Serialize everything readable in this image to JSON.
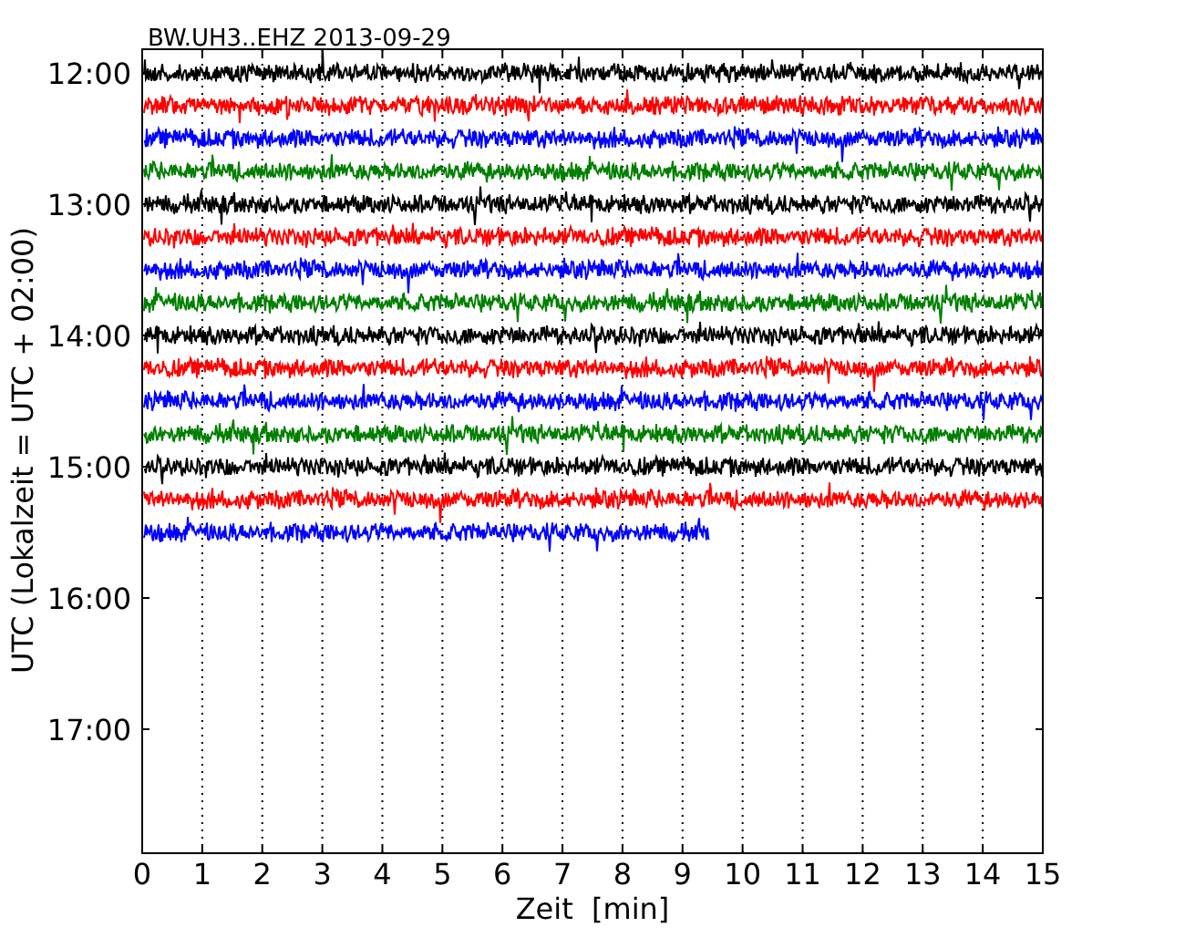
{
  "title": "BW.UH3..EHZ 2013-09-29",
  "xlabel": "Zeit  [min]",
  "ylabel": "UTC (Lokalzeit = UTC + 02:00)",
  "xticks": [
    "0",
    "1",
    "2",
    "3",
    "4",
    "5",
    "6",
    "7",
    "8",
    "9",
    "10",
    "11",
    "12",
    "13",
    "14",
    "15"
  ],
  "yticks": [
    "12:00",
    "13:00",
    "14:00",
    "15:00",
    "16:00",
    "17:00"
  ],
  "traces": [
    {
      "color": "#000000",
      "level": 1
    },
    {
      "color": "#ff0000",
      "level": 1
    },
    {
      "color": "#0000ff",
      "level": 1
    },
    {
      "color": "#008000",
      "level": 1
    },
    {
      "color": "#000000",
      "level": 1
    },
    {
      "color": "#ff0000",
      "level": 1
    },
    {
      "color": "#0000ff",
      "level": 1
    },
    {
      "color": "#008000",
      "level": 1
    },
    {
      "color": "#000000",
      "level": 1
    },
    {
      "color": "#ff0000",
      "level": 1
    },
    {
      "color": "#0000ff",
      "level": 1
    },
    {
      "color": "#008000",
      "level": 1
    },
    {
      "color": "#000000",
      "level": 1
    },
    {
      "color": "#ff0000",
      "level": 1
    },
    {
      "color": "#0000ff",
      "level": 0.63
    }
  ]
}
